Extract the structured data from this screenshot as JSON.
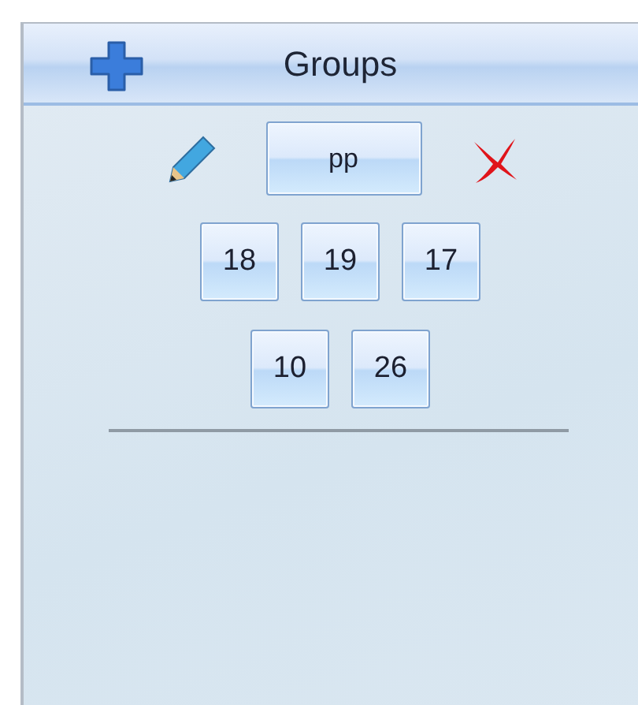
{
  "header": {
    "title": "Groups"
  },
  "current_group": {
    "label": "pp"
  },
  "group_rows": [
    {
      "buttons": [
        "18",
        "19",
        "17"
      ]
    },
    {
      "buttons": [
        "10",
        "26"
      ]
    }
  ]
}
